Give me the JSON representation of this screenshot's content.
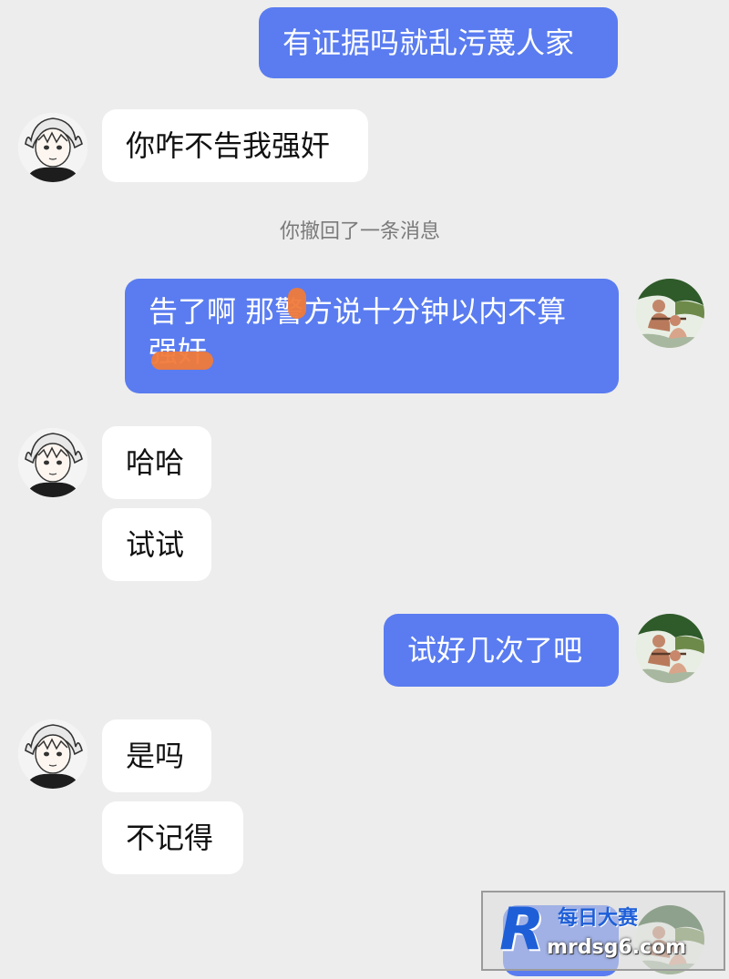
{
  "messages": [
    {
      "id": "m1",
      "side": "out",
      "text": "有证据吗就乱污蔑人家"
    },
    {
      "id": "m2",
      "side": "in",
      "text": "你咋不告我强奸"
    },
    {
      "id": "m4",
      "side": "out",
      "text": "告了啊 那警方说十分钟以内不算强奸"
    },
    {
      "id": "m5",
      "side": "in",
      "text": "哈哈"
    },
    {
      "id": "m6",
      "side": "in",
      "text": "试试"
    },
    {
      "id": "m7",
      "side": "out",
      "text": "试好几次了吧"
    },
    {
      "id": "m8",
      "side": "in",
      "text": "是吗"
    },
    {
      "id": "m9",
      "side": "in",
      "text": "不记得"
    }
  ],
  "system_note": "你撤回了一条消息",
  "avatars": {
    "contact": "anime-boy-avatar",
    "self": "outdoor-photo-avatar"
  },
  "colors": {
    "background": "#ededed",
    "outgoing_bubble": "#5a7cf0",
    "incoming_bubble": "#ffffff",
    "redaction": "#f07a3a"
  },
  "watermark": {
    "logo_letter": "R",
    "top_text": "每日大赛",
    "bottom_text": "mrdsg6.com"
  }
}
